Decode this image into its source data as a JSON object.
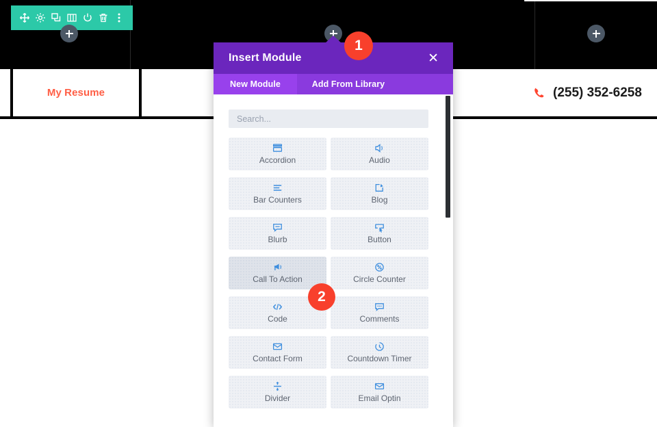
{
  "builder": {
    "section_toolbar": {
      "items": [
        {
          "name": "move-icon",
          "title": "Move Section"
        },
        {
          "name": "gear-icon",
          "title": "Section Settings"
        },
        {
          "name": "duplicate-icon",
          "title": "Duplicate Section"
        },
        {
          "name": "columns-icon",
          "title": "Change Column Structure"
        },
        {
          "name": "power-icon",
          "title": "Disable Section"
        },
        {
          "name": "trash-icon",
          "title": "Delete Section"
        },
        {
          "name": "more-options-icon",
          "title": "More Options"
        }
      ],
      "color": "#2cc9a8"
    },
    "add_buttons": [
      {
        "name": "add-module-left",
        "label": "+"
      },
      {
        "name": "add-module-center",
        "label": "+"
      },
      {
        "name": "add-module-right",
        "label": "+"
      }
    ]
  },
  "site_header": {
    "menu": [
      {
        "label": "My Resume"
      }
    ],
    "phone": {
      "icon": "phone-icon",
      "number": "(255) 352-6258"
    },
    "accent_color": "#ff5e45"
  },
  "modal": {
    "title": "Insert Module",
    "close_label": "✕",
    "tabs": [
      {
        "label": "New Module",
        "active": true
      },
      {
        "label": "Add From Library",
        "active": false
      }
    ],
    "search": {
      "value": "",
      "placeholder": "Search..."
    },
    "modules": [
      {
        "label": "Accordion",
        "icon": "accordion-icon"
      },
      {
        "label": "Audio",
        "icon": "audio-icon"
      },
      {
        "label": "Bar Counters",
        "icon": "bar-counters-icon"
      },
      {
        "label": "Blog",
        "icon": "blog-icon"
      },
      {
        "label": "Blurb",
        "icon": "blurb-icon"
      },
      {
        "label": "Button",
        "icon": "button-icon"
      },
      {
        "label": "Call To Action",
        "icon": "call-to-action-icon",
        "highlighted": true
      },
      {
        "label": "Circle Counter",
        "icon": "circle-counter-icon"
      },
      {
        "label": "Code",
        "icon": "code-icon"
      },
      {
        "label": "Comments",
        "icon": "comments-icon"
      },
      {
        "label": "Contact Form",
        "icon": "contact-form-icon"
      },
      {
        "label": "Countdown Timer",
        "icon": "countdown-timer-icon"
      },
      {
        "label": "Divider",
        "icon": "divider-icon"
      },
      {
        "label": "Email Optin",
        "icon": "email-optin-icon"
      }
    ],
    "header_color": "#6b26bd",
    "tabbar_color": "#8a3ade",
    "active_tab_color": "#9841ec"
  },
  "annotations": {
    "badges": [
      {
        "label": "1"
      },
      {
        "label": "2"
      }
    ],
    "badge_color": "#f8402c"
  }
}
